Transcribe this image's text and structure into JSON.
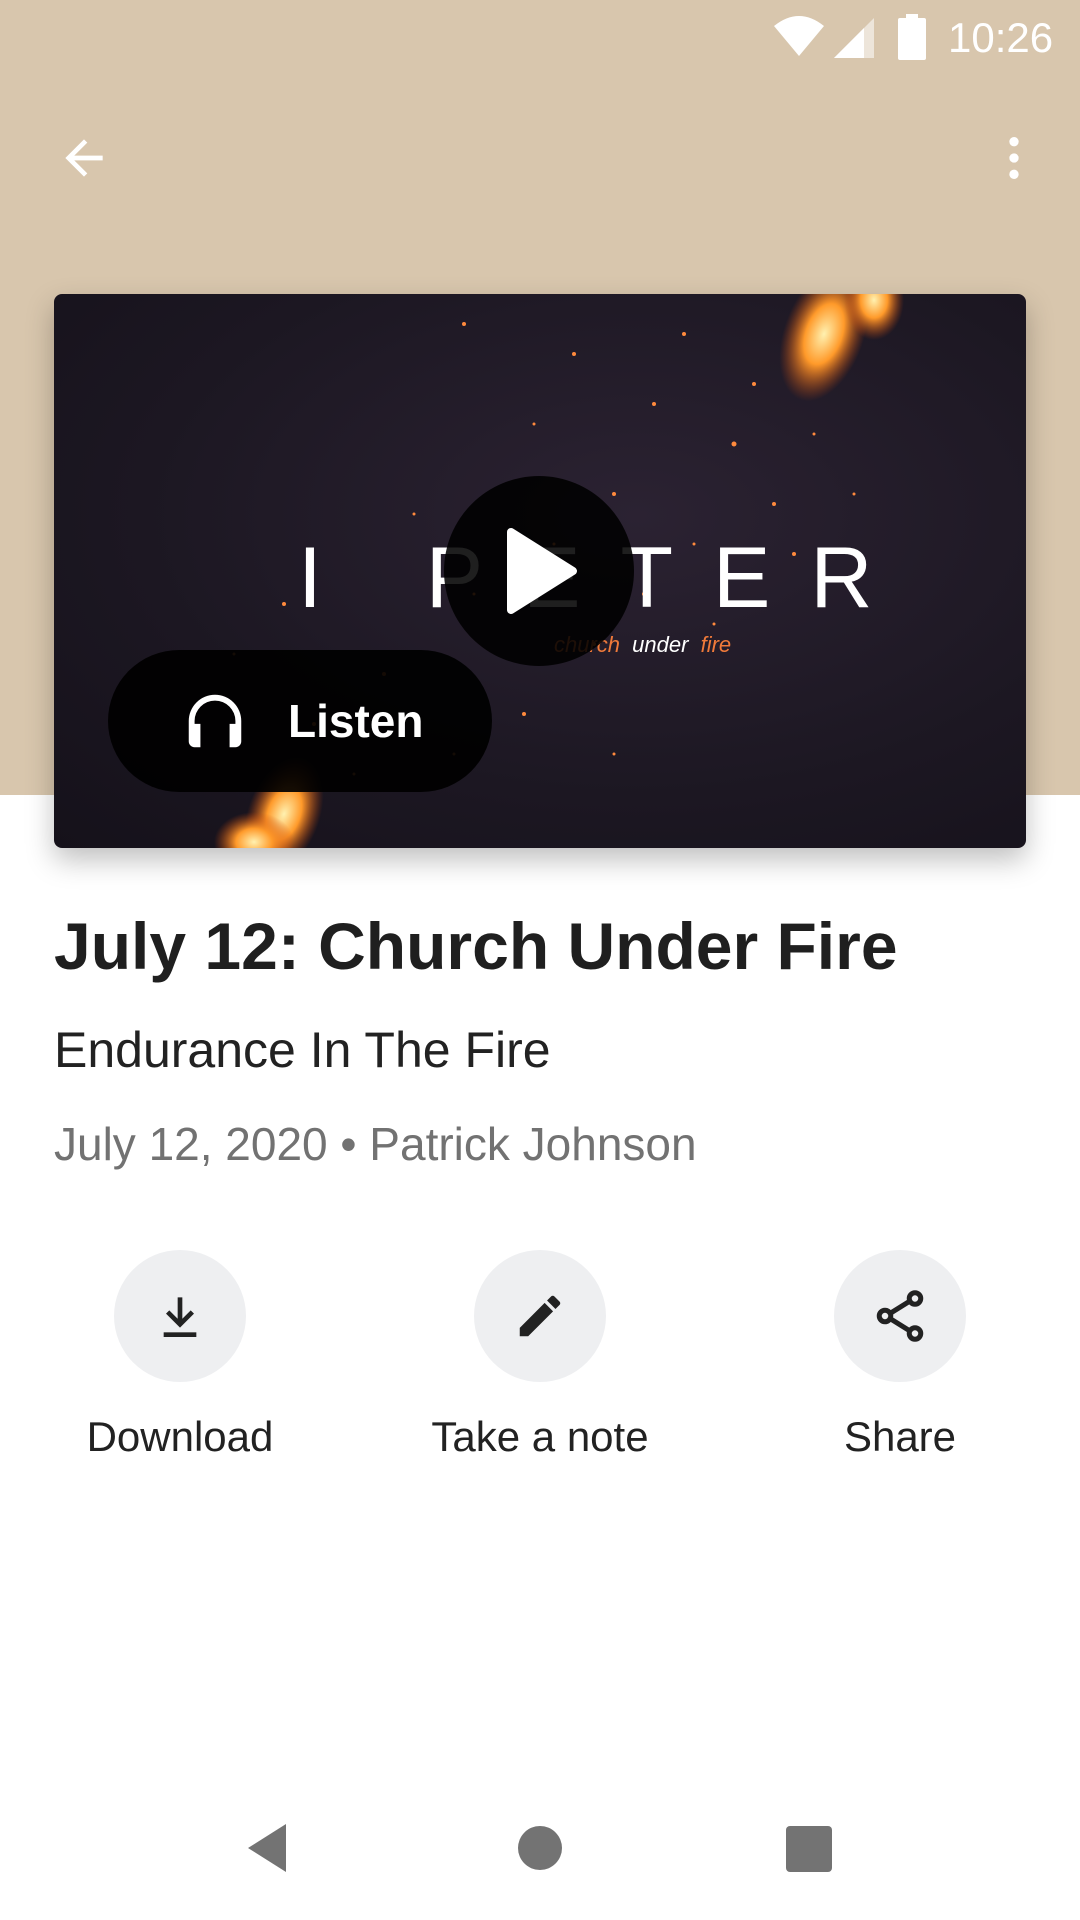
{
  "status_bar": {
    "time": "10:26",
    "icons": [
      "wifi-icon",
      "signal-icon",
      "battery-icon"
    ]
  },
  "app_bar": {
    "back_icon": "arrow-back-icon",
    "menu_icon": "more-vert-icon"
  },
  "media": {
    "art_title": "I PETER",
    "art_subtitle_part1": "church",
    "art_subtitle_part2": "under",
    "art_subtitle_part3": "fire",
    "play_icon": "play-icon",
    "listen_label": "Listen",
    "listen_icon": "headphones-icon"
  },
  "sermon": {
    "title": "July 12: Church Under Fire",
    "subtitle": "Endurance In The Fire",
    "meta": "July 12, 2020 • Patrick Johnson"
  },
  "actions": [
    {
      "label": "Download",
      "icon": "download-icon"
    },
    {
      "label": "Take a note",
      "icon": "pencil-icon"
    },
    {
      "label": "Share",
      "icon": "share-icon"
    }
  ],
  "colors": {
    "hero_background": "#d8c6ad",
    "action_circle": "#eeeff1",
    "accent_fire": "#f07a3a",
    "title_text": "#1f1f1f",
    "meta_text": "#727272"
  }
}
